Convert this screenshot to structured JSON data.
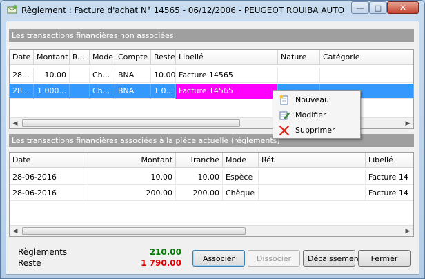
{
  "window": {
    "title": "Règlement : Facture d'achat N° 14565 - 06/12/2006 - PEUGEOT ROUIBA AUTO"
  },
  "unassociated": {
    "header": "Les transactions financières non associées",
    "columns": [
      "Date",
      "Montant",
      "R...",
      "Mode",
      "Compte",
      "Reste",
      "Libellé",
      "Nature",
      "Catégorie"
    ],
    "rows": [
      {
        "date": "28...",
        "montant": "10.00",
        "r": "",
        "mode": "Ch...",
        "compte": "BNA",
        "reste": "10.00",
        "libelle": "Facture 14565",
        "nature": "",
        "categorie": ""
      },
      {
        "date": "28...",
        "montant": "1 000...",
        "r": "",
        "mode": "Ch...",
        "compte": "BNA",
        "reste": "1 0...",
        "libelle": "Facture 14565",
        "nature": "",
        "categorie": ""
      }
    ]
  },
  "associated": {
    "header": "Les transactions financières associées à la piéce actuelle (réglements)",
    "columns": [
      "Date",
      "Montant",
      "Tranche",
      "Mode",
      "Réf.",
      "Libellé"
    ],
    "rows": [
      {
        "date": "28-06-2016",
        "montant": "10.00",
        "tranche": "10.00",
        "mode": "Espèce",
        "ref": "",
        "libelle": "Facture 14"
      },
      {
        "date": "28-06-2016",
        "montant": "200.00",
        "tranche": "200.00",
        "mode": "Chèque",
        "ref": "",
        "libelle": "Facture 14"
      }
    ]
  },
  "context_menu": {
    "items": [
      {
        "label": "Nouveau",
        "icon": "new-document-icon"
      },
      {
        "label": "Modifier",
        "icon": "edit-icon"
      },
      {
        "label": "Supprimer",
        "icon": "delete-x-icon"
      }
    ]
  },
  "footer": {
    "reglements_label": "Règlements",
    "reglements_value": "210.00",
    "reste_label": "Reste",
    "reste_value": "1 790.00"
  },
  "buttons": {
    "associer": "Associer",
    "dissocier": "Dissocier",
    "decaissement": "Décaissement",
    "fermer": "Fermer"
  },
  "colors": {
    "highlight": "#3399ff",
    "libelle_highlight": "#ff00ff",
    "positive": "#008000",
    "negative": "#e00000"
  }
}
